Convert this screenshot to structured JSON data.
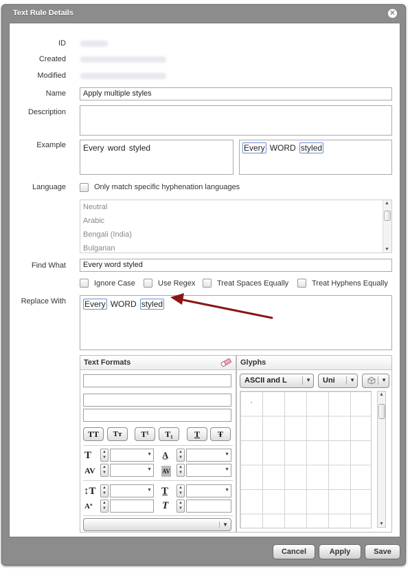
{
  "dialog": {
    "title": "Text Rule Details"
  },
  "labels": {
    "id": "ID",
    "created": "Created",
    "modified": "Modified",
    "name": "Name",
    "description": "Description",
    "example": "Example",
    "language": "Language",
    "find_what": "Find What",
    "replace_with": "Replace With"
  },
  "fields": {
    "name_value": "Apply multiple styles",
    "description_value": "",
    "example_plain_words": [
      "Every",
      "word",
      "styled"
    ],
    "example_styled_tokens": [
      "Every",
      "WORD",
      "styled"
    ],
    "find_what_value": "Every word styled",
    "replace_tokens": [
      "Every",
      "WORD",
      "styled"
    ]
  },
  "language": {
    "only_match_label": "Only match specific hyphenation languages",
    "only_match_checked": false,
    "items": [
      "Neutral",
      "Arabic",
      "Bengali (India)",
      "Bulgarian"
    ]
  },
  "options": {
    "ignore_case": "Ignore Case",
    "use_regex": "Use Regex",
    "treat_spaces": "Treat Spaces Equally",
    "treat_hyphens": "Treat Hyphens Equally"
  },
  "text_formats": {
    "title": "Text Formats",
    "format_buttons": [
      "TT",
      "Tт",
      "T¹",
      "T₁",
      "T",
      "Ŧ"
    ]
  },
  "glyphs": {
    "title": "Glyphs",
    "charset": "ASCII and L",
    "encoding": "Uni",
    "first_glyph": "·"
  },
  "buttons": {
    "cancel": "Cancel",
    "apply": "Apply",
    "save": "Save"
  },
  "colors": {
    "annotation_arrow": "#8b1414",
    "token_border": "#6a8fd0"
  }
}
